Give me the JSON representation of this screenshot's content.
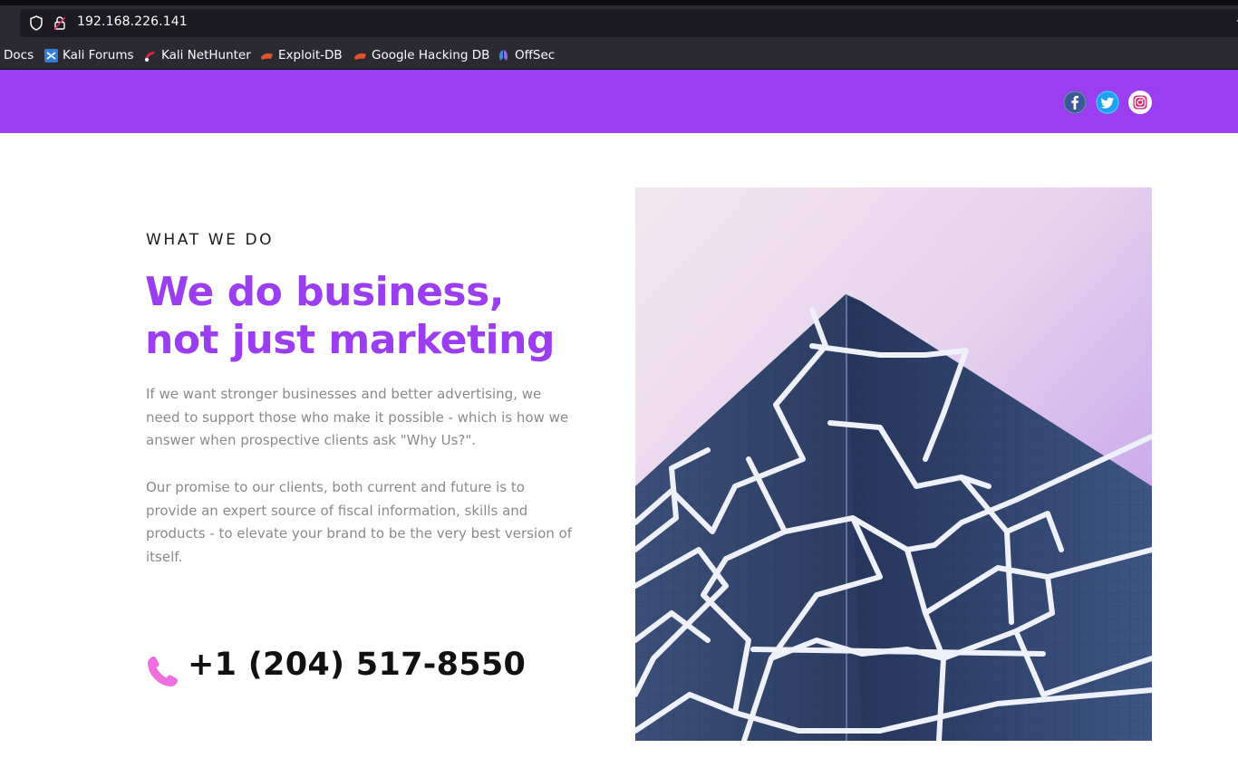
{
  "browser": {
    "url": "192.168.226.141",
    "bookmarks": [
      {
        "label": "Docs",
        "icon": "docs-icon"
      },
      {
        "label": "Kali Forums",
        "icon": "kali-forums-icon"
      },
      {
        "label": "Kali NetHunter",
        "icon": "kali-nethunter-icon"
      },
      {
        "label": "Exploit-DB",
        "icon": "exploit-db-icon"
      },
      {
        "label": "Google Hacking DB",
        "icon": "google-hacking-db-icon"
      },
      {
        "label": "OffSec",
        "icon": "offsec-icon"
      }
    ]
  },
  "header": {
    "background": "#9b3df0",
    "social": [
      {
        "name": "facebook",
        "icon": "facebook-icon",
        "color": "#3b5998"
      },
      {
        "name": "twitter",
        "icon": "twitter-icon",
        "color": "#1da1f2"
      },
      {
        "name": "instagram",
        "icon": "instagram-icon",
        "color": "#e1306c"
      }
    ]
  },
  "section": {
    "eyebrow": "WHAT WE DO",
    "headline_line1": "We do business,",
    "headline_line2": "not just marketing",
    "paragraph1": "If we want stronger businesses and better advertising, we need to support those who make it possible - which is how we answer when prospective clients ask \"Why Us?\".",
    "paragraph2": "Our promise to our clients, both current and future is to provide an expert source of fiscal information, skills and products - to elevate your brand to be the very best version of itself.",
    "phone": "+1 (204) 517-8550",
    "accent_color": "#9b3df0",
    "phone_icon": "phone-icon",
    "image_alt": "building-photo"
  }
}
